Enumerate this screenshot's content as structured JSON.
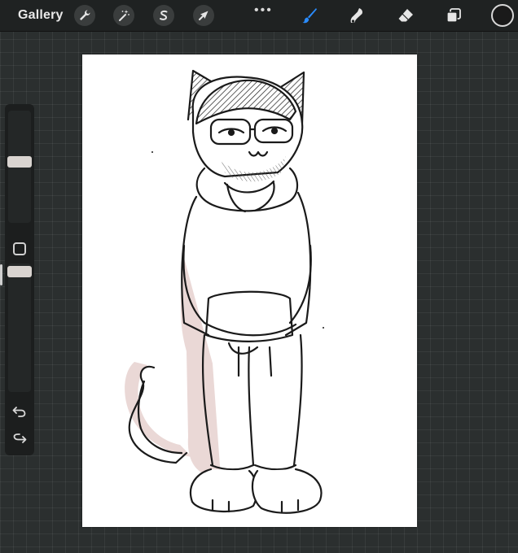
{
  "app": {
    "gallery_label": "Gallery",
    "more_glyph": "•••"
  },
  "toolbar": {
    "left_tools": [
      {
        "name": "actions",
        "icon": "wrench-icon"
      },
      {
        "name": "adjustments",
        "icon": "magic-wand-icon"
      },
      {
        "name": "selection",
        "icon": "selection-s-icon"
      },
      {
        "name": "transform",
        "icon": "arrow-cursor-icon"
      }
    ],
    "right_tools": [
      {
        "name": "brush",
        "icon": "brush-icon",
        "active": true
      },
      {
        "name": "smudge",
        "icon": "smudge-icon",
        "active": false
      },
      {
        "name": "eraser",
        "icon": "eraser-icon",
        "active": false
      },
      {
        "name": "layers",
        "icon": "layers-icon",
        "active": false
      }
    ],
    "current_color": "#1a1a1a",
    "active_color": "#2a8cff"
  },
  "sidebar": {
    "brush_size_level": 0.55,
    "brush_opacity_level": 0.98,
    "modify_button": "square-outline-icon",
    "undo": "undo-icon",
    "redo": "redo-icon"
  },
  "canvas": {
    "artwork": "cat-character-sketch",
    "background": "#ffffff",
    "ink": "#1a1a1a",
    "shadow_tint": "#ead8d6"
  }
}
